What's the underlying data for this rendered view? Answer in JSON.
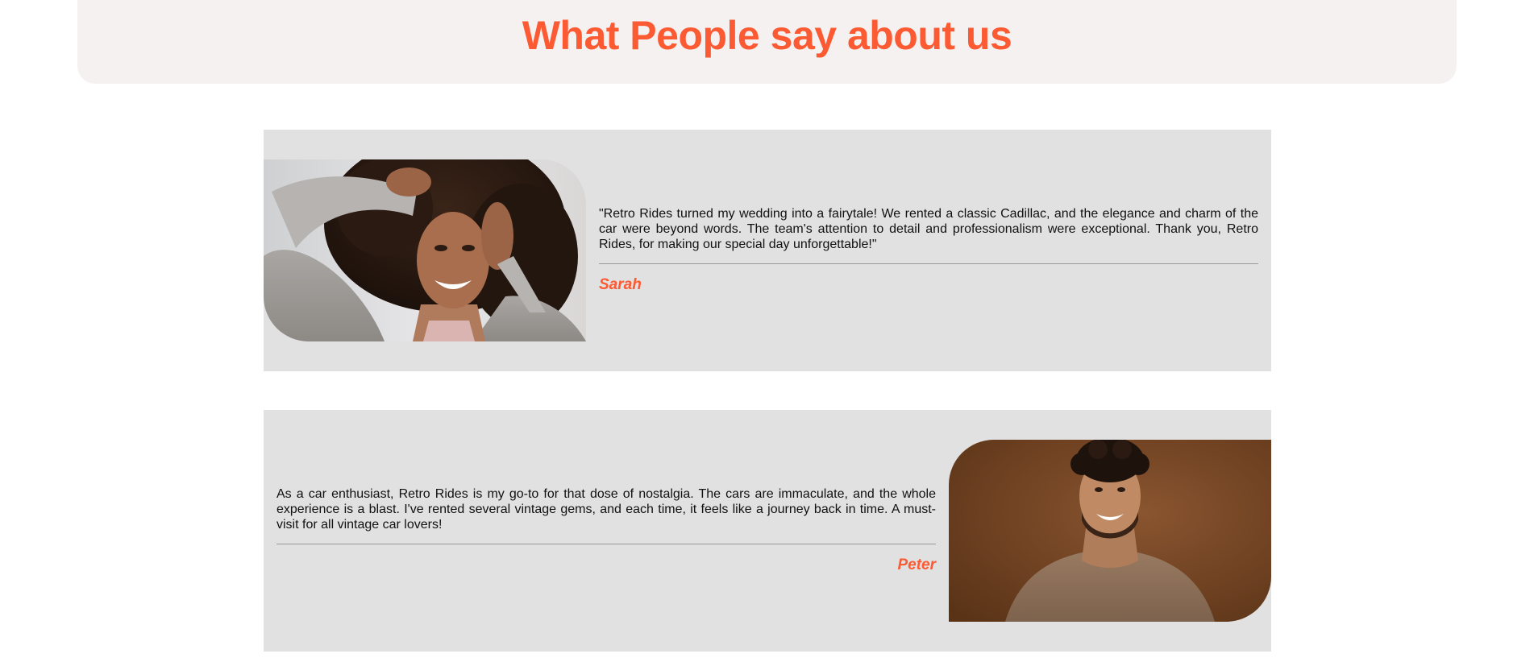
{
  "header": {
    "title": "What People say about us"
  },
  "testimonials": [
    {
      "quote": "\"Retro Rides turned my wedding into a fairytale! We rented a classic Cadillac, and the elegance and charm of the car were beyond words. The team's attention to detail and professionalism were exceptional. Thank you, Retro Rides, for making our special day unforgettable!\"",
      "author": "Sarah"
    },
    {
      "quote": "As a car enthusiast, Retro Rides is my go-to for that dose of nostalgia. The cars are immaculate, and the whole experience is a blast. I've rented several vintage gems, and each time, it feels like a journey back in time. A must-visit for all vintage car lovers!",
      "author": "Peter"
    }
  ],
  "colors": {
    "accent": "#fb5a33",
    "header_bg": "#f5f1f1",
    "card_bg": "#e1e1e1"
  }
}
